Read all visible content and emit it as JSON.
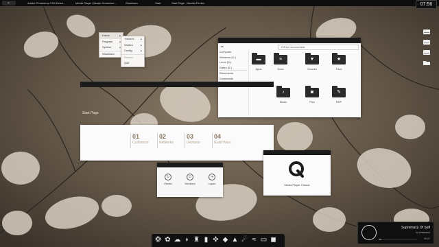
{
  "taskbar": {
    "start_glyph": "⌄",
    "tasks": [
      "Adobe Photoshop CS4 Exten...",
      "Media Player Classic Homecine...",
      "Shutdown",
      "Start",
      "Start Page - Mozilla Firefox"
    ],
    "clock": "07:56"
  },
  "start_menu": {
    "items": [
      {
        "label": "Home",
        "arrow": "▸"
      },
      {
        "label": "Program",
        "arrow": "▸"
      },
      {
        "label": "System",
        "arrow": "▸"
      },
      {
        "label": "Shutdown",
        "arrow": ""
      }
    ]
  },
  "sub_menu": {
    "items": [
      {
        "label": "Themes",
        "arrow": "▸"
      },
      {
        "label": "Wallies",
        "arrow": "▸"
      },
      {
        "label": "Config",
        "arrow": "▸"
      },
      {
        "label": "Reload",
        "arrow": ""
      },
      {
        "label": "Quit",
        "arrow": ""
      }
    ]
  },
  "explorer": {
    "nav": "◂ ▸",
    "address": "E:\\Paux documents\\ar",
    "sidebar": [
      "Computer",
      "Windows (C:)",
      "Linux (D:)",
      "Daten (E:)",
      "Documents",
      "Downloads"
    ],
    "folders": [
      {
        "label": "Apps",
        "glyph": "▬"
      },
      {
        "label": "Docs",
        "glyph": "≡"
      },
      {
        "label": "Downlo",
        "glyph": "▼"
      },
      {
        "label": "Favs",
        "glyph": "★"
      },
      {
        "label": "Music",
        "glyph": "♪"
      },
      {
        "label": "Pics",
        "glyph": "◙"
      },
      {
        "label": "RHP",
        "glyph": "✎"
      }
    ]
  },
  "start_page": {
    "label": "Start Page",
    "tiles": [
      {
        "num": "01",
        "label": "Customize"
      },
      {
        "num": "02",
        "label": "Networks"
      },
      {
        "num": "03",
        "label": "Deviants"
      },
      {
        "num": "04",
        "label": "Guild Wars"
      }
    ]
  },
  "shutdown": {
    "buttons": [
      {
        "label": "Restart",
        "glyph": "↻"
      },
      {
        "label": "Shutdown",
        "glyph": "⏻"
      },
      {
        "label": "Logout",
        "glyph": "⇥"
      }
    ]
  },
  "mpc": {
    "label": "Media Player Classic"
  },
  "dock": {
    "icons": [
      "❂",
      "✿",
      "☁",
      "◗",
      "♜",
      "▮",
      "✜",
      "◆",
      "▲",
      "☄",
      "≈",
      "▭",
      "◼"
    ]
  },
  "music": {
    "song": "Supremacy Of Self",
    "artist": "by Hawkwind",
    "time": "00:07",
    "progress": 0.08
  },
  "colors": {
    "accent": "#8b7761",
    "titlebar": "#1b1b1b"
  }
}
